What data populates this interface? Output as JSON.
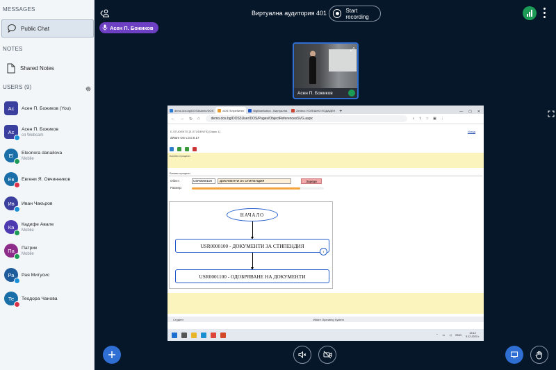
{
  "sidebar": {
    "messages_title": "MESSAGES",
    "public_chat_label": "Public Chat",
    "notes_title": "NOTES",
    "shared_notes_label": "Shared Notes",
    "users_title": "USERS (9)",
    "users": [
      {
        "initials": "Ac",
        "name": "Асен П. Божиков (You)",
        "sub": "",
        "color": "#3b3f9e",
        "square": true
      },
      {
        "initials": "Ac",
        "name": "Асен П. Божиков",
        "sub": "cя Webcam",
        "color": "#3b3f9e",
        "square": true
      },
      {
        "initials": "El",
        "name": "Eleonora danailova",
        "sub": "Mobile",
        "color": "#1b6fa8",
        "square": false
      },
      {
        "initials": "Ев",
        "name": "Евгени Я. Овчинников",
        "sub": "",
        "color": "#1b6fa8",
        "square": false
      },
      {
        "initials": "Ив",
        "name": "Иван Чакъров",
        "sub": "",
        "color": "#3b3f9e",
        "square": false
      },
      {
        "initials": "Ка",
        "name": "Кадифе Авале",
        "sub": "Mobile",
        "color": "#4e3ab0",
        "square": false
      },
      {
        "initials": "Па",
        "name": "Патрик",
        "sub": "Mobile",
        "color": "#8e2c8a",
        "square": false
      },
      {
        "initials": "Ра",
        "name": "Рая Митусис",
        "sub": "",
        "color": "#1f5c9c",
        "square": false
      },
      {
        "initials": "Те",
        "name": "Теодора Чанова",
        "sub": "",
        "color": "#1b6fa8",
        "square": false
      }
    ]
  },
  "header": {
    "room_title": "Виртуална аудитория 401",
    "record_label": "Start recording",
    "talking_user": "Асен П. Божиков"
  },
  "webcam": {
    "name": "Асен П. Божиков"
  },
  "screen": {
    "tabs": [
      {
        "label": "demo.dos.bg/DOS3Admin/DOS",
        "active": false,
        "color": "#2b7bd6"
      },
      {
        "label": "dOS Потребител",
        "active": true,
        "color": "#e69b2f"
      },
      {
        "label": "BigBlueButton - Виртуална",
        "active": false,
        "color": "#1c58c9"
      },
      {
        "label": "Zimbra: УСПЕШНО ПОДАДЕН",
        "active": false,
        "color": "#c43"
      }
    ],
    "url": "demo.dos.bg/DOS3User/DOS/Pages/ObjectReferencesSVG.aspx",
    "app_header": "E-STUDENTS [E-STUDENTS] [Офис 1]",
    "app_version": "dWare OS v.3.0.0.17",
    "help_link": "Изход",
    "process_label": "Бизнес процеси",
    "section_label": "Бизнес процеси",
    "object_label": "Обект:",
    "object_code": "USR0000100",
    "object_name": "ДОКУМЕНТИ ЗА СТИПЕНДИЯ",
    "load_button": "Зареди",
    "size_label": "Размер:",
    "size_value": 0.82,
    "diagram": {
      "start": "НАЧАЛО",
      "step1": "USR0000100 - ДОКУМЕНТИ ЗА СТИПЕНДИЯ",
      "step2": "USR0001100 - ОДОБРЯВАНЕ НА ДОКУМЕНТИ"
    },
    "status_left": "Студент",
    "status_center": "dWare Operating System",
    "taskbar": {
      "lang": "ENG",
      "time": "13:12",
      "date": "5.12.2023 г."
    }
  }
}
